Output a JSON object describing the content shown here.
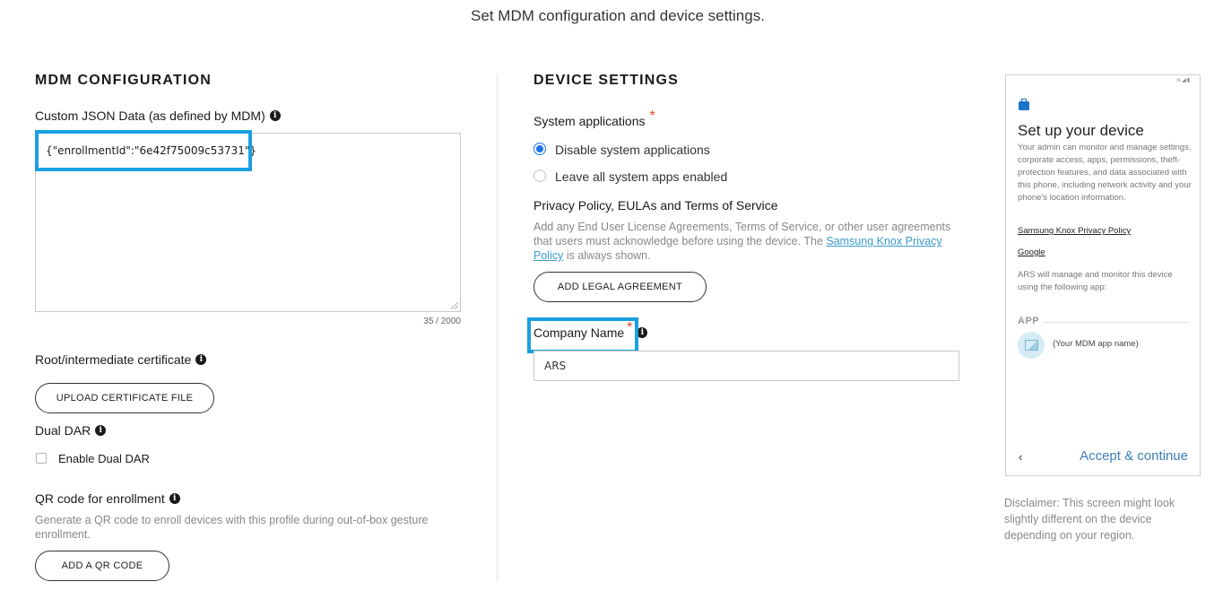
{
  "header": {
    "subtitle": "Set MDM configuration and device settings."
  },
  "mdm": {
    "section_title": "MDM CONFIGURATION",
    "custom_json_label": "Custom JSON Data (as defined by MDM)",
    "custom_json_value": "{\"enrollmentId\":\"6e42f75009c53731\"}",
    "char_count": "35 / 2000",
    "root_cert_label": "Root/intermediate certificate",
    "upload_cert_button": "UPLOAD CERTIFICATE FILE",
    "dual_dar_label": "Dual DAR",
    "enable_dual_dar_label": "Enable Dual DAR",
    "qr_label": "QR code for enrollment",
    "qr_desc": "Generate a QR code to enroll devices with this profile during out-of-box gesture enrollment.",
    "add_qr_button": "ADD A QR CODE"
  },
  "device": {
    "section_title": "DEVICE SETTINGS",
    "system_apps_label": "System applications",
    "required_mark": "*",
    "radio_disable": "Disable system applications",
    "radio_leave": "Leave all system apps enabled",
    "privacy_title": "Privacy Policy, EULAs and Terms of Service",
    "privacy_desc_before": "Add any End User License Agreements, Terms of Service, or other user agreements that users must acknowledge before using the device. The ",
    "privacy_link": "Samsung Knox Privacy Policy",
    "privacy_desc_after": " is always shown.",
    "add_legal_button": "ADD LEGAL AGREEMENT",
    "company_name_label": "Company Name",
    "company_name_value": "ARS"
  },
  "preview": {
    "status_icons": "≋◢▮",
    "title": "Set up your device",
    "desc": "Your admin can monitor and manage settings, corporate access, apps, permissions, theft-protection features, and data associated with this phone, including network activity and your phone's location information.",
    "knox_link": "Samsung Knox Privacy Policy",
    "google_link": "Google",
    "manage_text": "ARS will manage and monitor this device using the following app:",
    "app_heading": "APP",
    "app_name": "(Your MDM app name)",
    "back_glyph": "‹",
    "accept_label": "Accept & continue"
  },
  "disclaimer": "Disclaimer: This screen might look slightly different on the device depending on your region.",
  "colors": {
    "highlight": "#1aa0e0",
    "accent": "#1a73e8",
    "link": "#3c9ac9",
    "required": "#e0482c"
  }
}
